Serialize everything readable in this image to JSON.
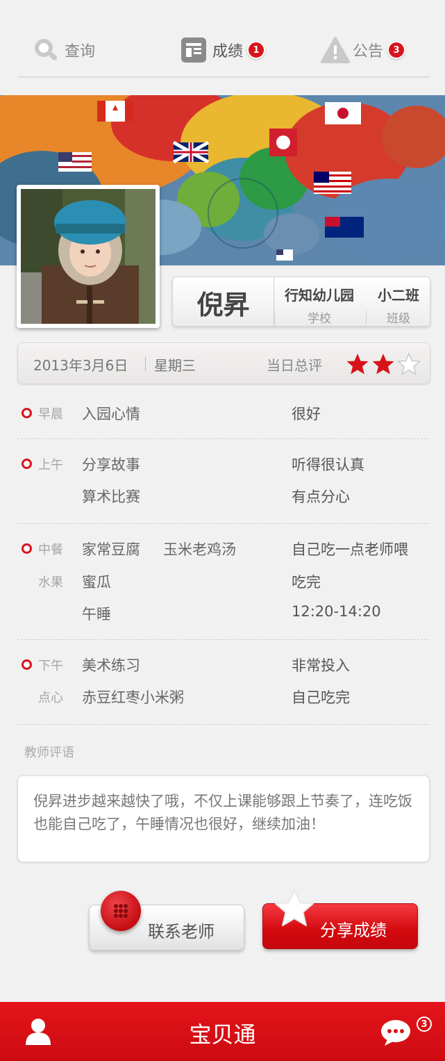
{
  "tabs": [
    {
      "label": "查询",
      "icon": "search-icon"
    },
    {
      "label": "成绩",
      "icon": "report-icon",
      "badge": "1"
    },
    {
      "label": "公告",
      "icon": "warning-icon",
      "badge": "3"
    }
  ],
  "student": {
    "name": "倪昇",
    "school": "行知幼儿园",
    "school_label": "学校",
    "class": "小二班",
    "class_label": "班级"
  },
  "day": {
    "date": "2013年3月6日",
    "weekday": "星期三",
    "eval_label": "当日总评",
    "rating": 2,
    "rating_max": 3
  },
  "schedule": {
    "morning": {
      "period": "早晨",
      "item": "入园心情",
      "result": "很好"
    },
    "am": {
      "period": "上午",
      "rows": [
        {
          "item": "分享故事",
          "result": "听得很认真"
        },
        {
          "item": "算术比赛",
          "result": "有点分心"
        }
      ]
    },
    "lunch": {
      "period": "中餐",
      "item": "家常豆腐",
      "item2": "玉米老鸡汤",
      "result": "自己吃一点老师喂",
      "fruit_period": "水果",
      "fruit_item": "蜜瓜",
      "fruit_result": "吃完",
      "nap_item": "午睡",
      "nap_result": "12:20-14:20"
    },
    "pm": {
      "period": "下午",
      "item": "美术练习",
      "result": "非常投入",
      "snack_period": "点心",
      "snack_item": "赤豆红枣小米粥",
      "snack_result": "自己吃完"
    }
  },
  "comment": {
    "label": "教师评语",
    "text": "倪昇进步越来越快了哦，不仅上课能够跟上节奏了，连吃饭也能自己吃了，午睡情况也很好，继续加油！"
  },
  "buttons": {
    "contact": "联系老师",
    "share": "分享成绩"
  },
  "bottombar": {
    "title": "宝贝通",
    "chat_badge": "3"
  },
  "colors": {
    "accent": "#d8141b",
    "background": "#f2f1f1"
  }
}
